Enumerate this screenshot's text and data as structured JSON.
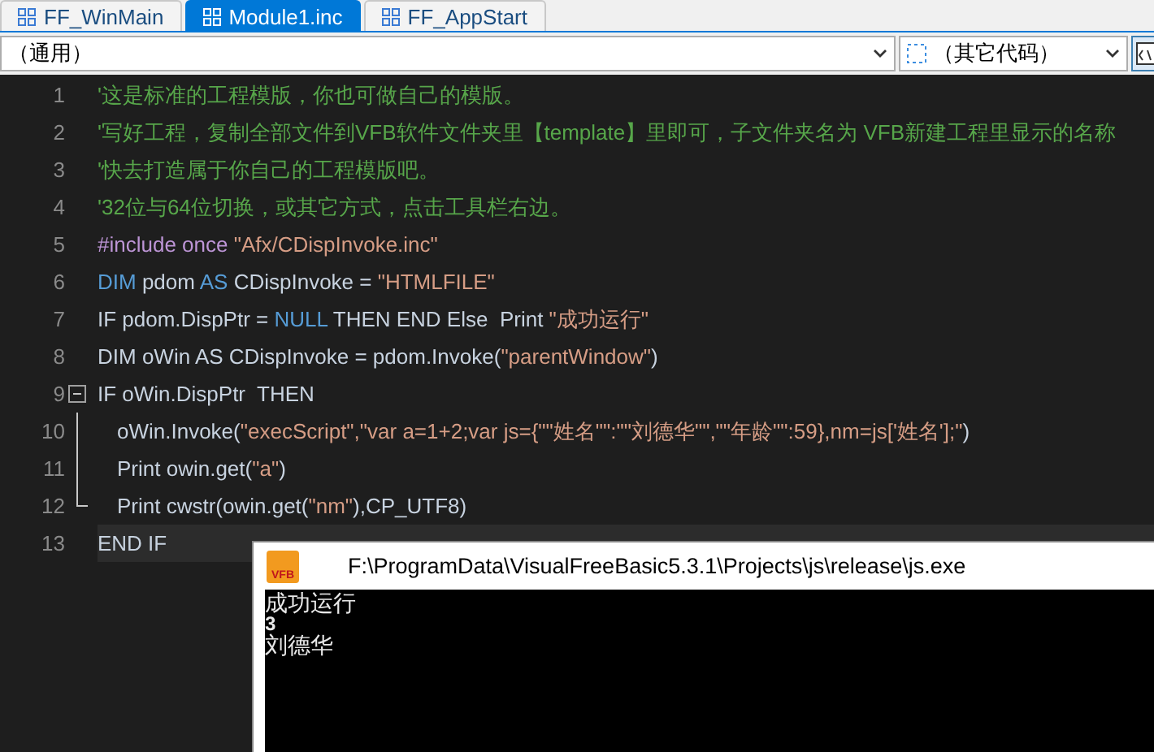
{
  "tabs": [
    {
      "label": "FF_WinMain",
      "selected": false
    },
    {
      "label": "Module1.inc",
      "selected": true
    },
    {
      "label": "FF_AppStart",
      "selected": false
    }
  ],
  "toolbar": {
    "scope_dropdown": "（通用）",
    "member_dropdown": "（其它代码）"
  },
  "editor": {
    "lines": [
      {
        "number": "1",
        "current": false,
        "tokens": [
          {
            "kind": "comment",
            "text": "'这是标准的工程模版，你也可做自己的模版。"
          }
        ]
      },
      {
        "number": "2",
        "current": false,
        "tokens": [
          {
            "kind": "comment",
            "text": "'写好工程，复制全部文件到VFB软件文件夹里【template】里即可，子文件夹名为 VFB新建工程里显示的名称"
          }
        ]
      },
      {
        "number": "3",
        "current": false,
        "tokens": [
          {
            "kind": "comment",
            "text": "'快去打造属于你自己的工程模版吧。"
          }
        ]
      },
      {
        "number": "4",
        "current": false,
        "tokens": [
          {
            "kind": "comment",
            "text": "'32位与64位切换，或其它方式，点击工具栏右边。"
          }
        ]
      },
      {
        "number": "5",
        "current": false,
        "tokens": [
          {
            "kind": "preproc",
            "text": "#include once "
          },
          {
            "kind": "string",
            "text": "\"Afx/CDispInvoke.inc\""
          }
        ]
      },
      {
        "number": "6",
        "current": false,
        "tokens": [
          {
            "kind": "keyword",
            "text": "DIM"
          },
          {
            "kind": "plain",
            "text": " pdom "
          },
          {
            "kind": "keyword",
            "text": "AS"
          },
          {
            "kind": "plain",
            "text": " CDispInvoke = "
          },
          {
            "kind": "string",
            "text": "\"HTMLFILE\""
          }
        ]
      },
      {
        "number": "7",
        "current": false,
        "tokens": [
          {
            "kind": "plain",
            "text": "IF pdom.DispPtr = "
          },
          {
            "kind": "keyword",
            "text": "NULL"
          },
          {
            "kind": "plain",
            "text": " THEN END Else  Print "
          },
          {
            "kind": "string",
            "text": "\"成功运行\""
          }
        ]
      },
      {
        "number": "8",
        "current": false,
        "tokens": [
          {
            "kind": "plain",
            "text": "DIM oWin AS CDispInvoke = pdom.Invoke("
          },
          {
            "kind": "string",
            "text": "\"parentWindow\""
          },
          {
            "kind": "plain",
            "text": ")"
          }
        ]
      },
      {
        "number": "9",
        "current": false,
        "expanded": true,
        "tokens": [
          {
            "kind": "plain",
            "text": "IF oWin.DispPtr  THEN"
          }
        ],
        "children": [
          {
            "number": "10",
            "current": false,
            "tokens": [
              {
                "kind": "plain",
                "text": "oWin.Invoke("
              },
              {
                "kind": "string",
                "text": "\"execScript\",\"var a=1+2;var js={\"\"姓名\"\":\"\"刘德华\"\",\"\"年龄\"\":59},nm=js['姓名'];\""
              },
              {
                "kind": "plain",
                "text": ")"
              }
            ]
          },
          {
            "number": "11",
            "current": false,
            "tokens": [
              {
                "kind": "plain",
                "text": "Print owin.get("
              },
              {
                "kind": "string",
                "text": "\"a\""
              },
              {
                "kind": "plain",
                "text": ")"
              }
            ]
          },
          {
            "number": "12",
            "current": false,
            "tokens": [
              {
                "kind": "plain",
                "text": "Print cwstr(owin.get("
              },
              {
                "kind": "string",
                "text": "\"nm\""
              },
              {
                "kind": "plain",
                "text": "),CP_UTF8)"
              }
            ]
          }
        ]
      },
      {
        "number": "13",
        "current": true,
        "tokens": [
          {
            "kind": "plain",
            "text": "END IF"
          }
        ]
      }
    ]
  },
  "console": {
    "title": "F:\\ProgramData\\VisualFreeBasic5.3.1\\Projects\\js\\release\\js.exe",
    "app_icon_label": "VFB",
    "lines": [
      "成功运行",
      "3",
      "刘德华"
    ]
  }
}
